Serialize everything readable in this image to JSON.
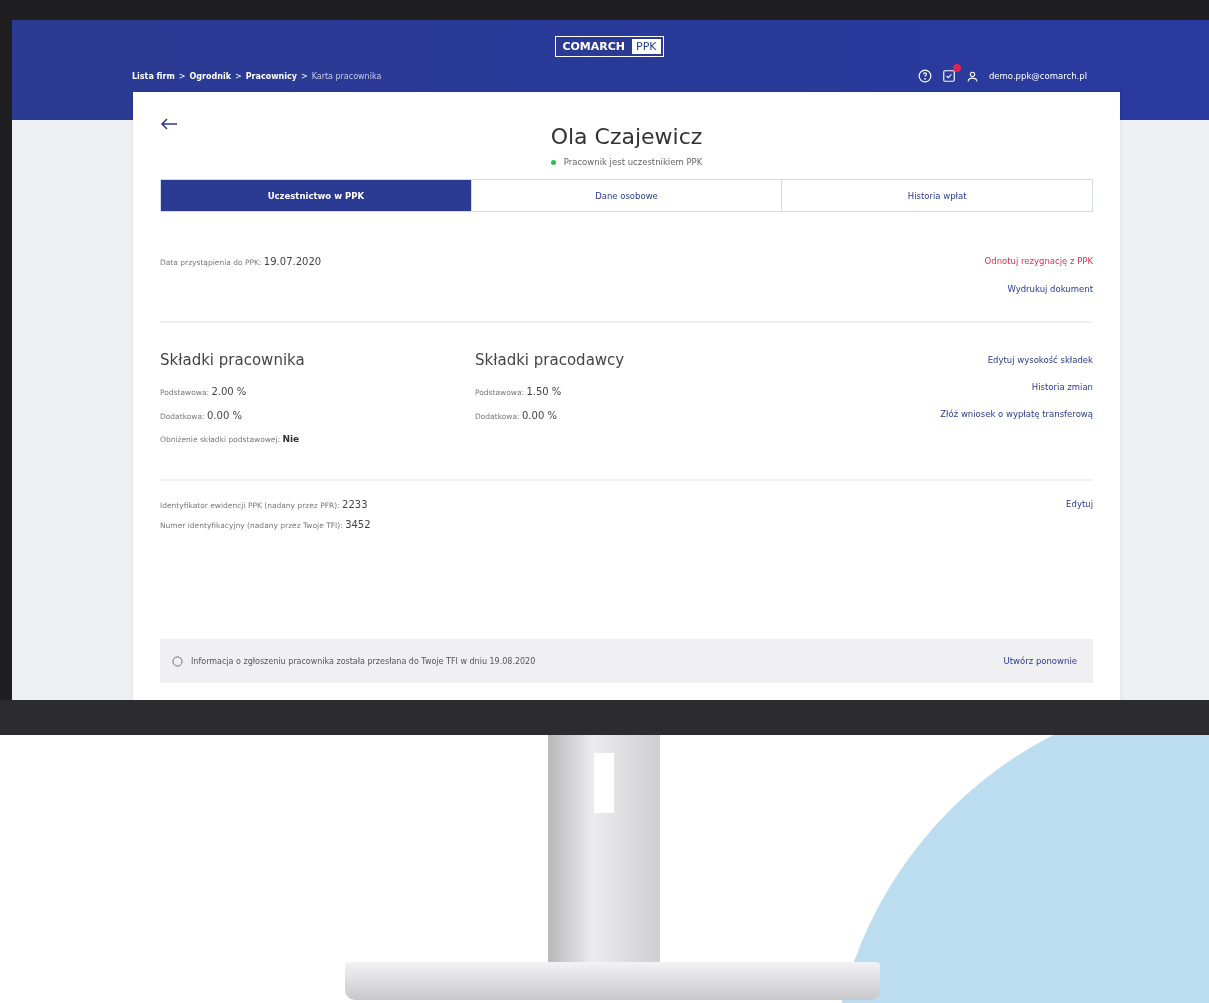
{
  "header": {
    "logo": {
      "brand": "COMARCH",
      "product": "PPK"
    },
    "breadcrumb": [
      {
        "label": "Lista firm",
        "current": false
      },
      {
        "label": "Ogrodnik",
        "current": false
      },
      {
        "label": "Pracownicy",
        "current": false
      },
      {
        "label": "Karta pracownika",
        "current": true
      }
    ],
    "breadcrumb_separator": ">",
    "tasks_badge": true,
    "user_email": "demo.ppk@comarch.pl"
  },
  "employee": {
    "name": "Ola Czajewicz",
    "status": {
      "text": "Pracownik jest uczestnikiem PPK",
      "color": "#2fbf4a"
    }
  },
  "tabs": [
    {
      "label": "Uczestnictwo w PPK",
      "selected": true
    },
    {
      "label": "Dane osobowe",
      "selected": false
    },
    {
      "label": "Historia wpłat",
      "selected": false
    }
  ],
  "join": {
    "label": "Data przystąpienia do PPK:",
    "value": "19.07.2020"
  },
  "join_links": [
    {
      "label": "Odnotuj rezygnację z PPK",
      "kind": "danger"
    },
    {
      "label": "Wydrukuj dokument",
      "kind": "link"
    }
  ],
  "contributions": [
    {
      "title": "Składki pracownika",
      "rows": [
        {
          "label": "Podstawowa:",
          "value": "2.00 %"
        },
        {
          "label": "Dodatkowa:",
          "value": "0.00 %"
        },
        {
          "label": "Obniżenie składki podstawowej:",
          "value": "Nie"
        }
      ]
    },
    {
      "title": "Składki pracodawcy",
      "rows": [
        {
          "label": "Podstawowa:",
          "value": "1.50 %"
        },
        {
          "label": "Dodatkowa:",
          "value": "0.00 %"
        }
      ]
    }
  ],
  "contribution_links": [
    {
      "label": "Edytuj wysokość składek"
    },
    {
      "label": "Historia zmian"
    },
    {
      "label": "Złóż wniosek o wypłatę transferową"
    }
  ],
  "identifiers": [
    {
      "label": "Identyfikator ewidencji PPK (nadany przez PFR):",
      "value": "2233"
    },
    {
      "label": "Numer identyfikacyjny (nadany przez Twoje TFI):",
      "value": "3452"
    }
  ],
  "identifiers_link": {
    "label": "Edytuj"
  },
  "info_bar": {
    "text": "Informacja o zgłoszeniu pracownika została przesłana do Twoje TFI w dniu 19.08.2020",
    "action": "Utwórz ponownie"
  }
}
